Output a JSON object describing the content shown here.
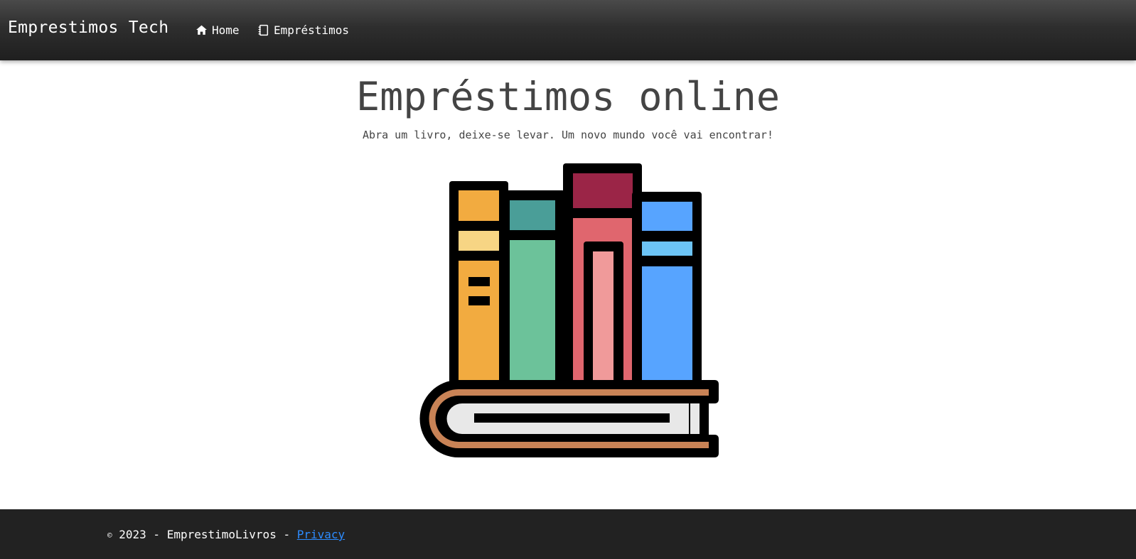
{
  "navbar": {
    "brand": "Emprestimos Tech",
    "links": [
      {
        "label": "Home",
        "icon": "home-icon"
      },
      {
        "label": "Empréstimos",
        "icon": "notebook-icon"
      }
    ]
  },
  "hero": {
    "title": "Empréstimos online",
    "subtitle": "Abra um livro, deixe-se levar. Um novo mundo você vai encontrar!",
    "image_icon": "books-stack-illustration"
  },
  "footer": {
    "copyright_symbol": "©",
    "text": "2023 - EmprestimoLivros - ",
    "privacy_label": "Privacy"
  },
  "colors": {
    "navbar_bg": "#2e2e2e",
    "footer_bg": "#222222",
    "title_text": "#444444",
    "link": "#2d8cff",
    "book_orange": "#f2ab40",
    "book_yellow": "#f7d584",
    "book_teal": "#4a9e98",
    "book_green": "#6cc29a",
    "book_maroon": "#9b2547",
    "book_red": "#e0666e",
    "book_pink": "#f09a9a",
    "book_blue": "#57a4ff",
    "book_lightblue": "#6cc4f5",
    "book_brown": "#c98356",
    "book_pages": "#e8e8e8"
  }
}
